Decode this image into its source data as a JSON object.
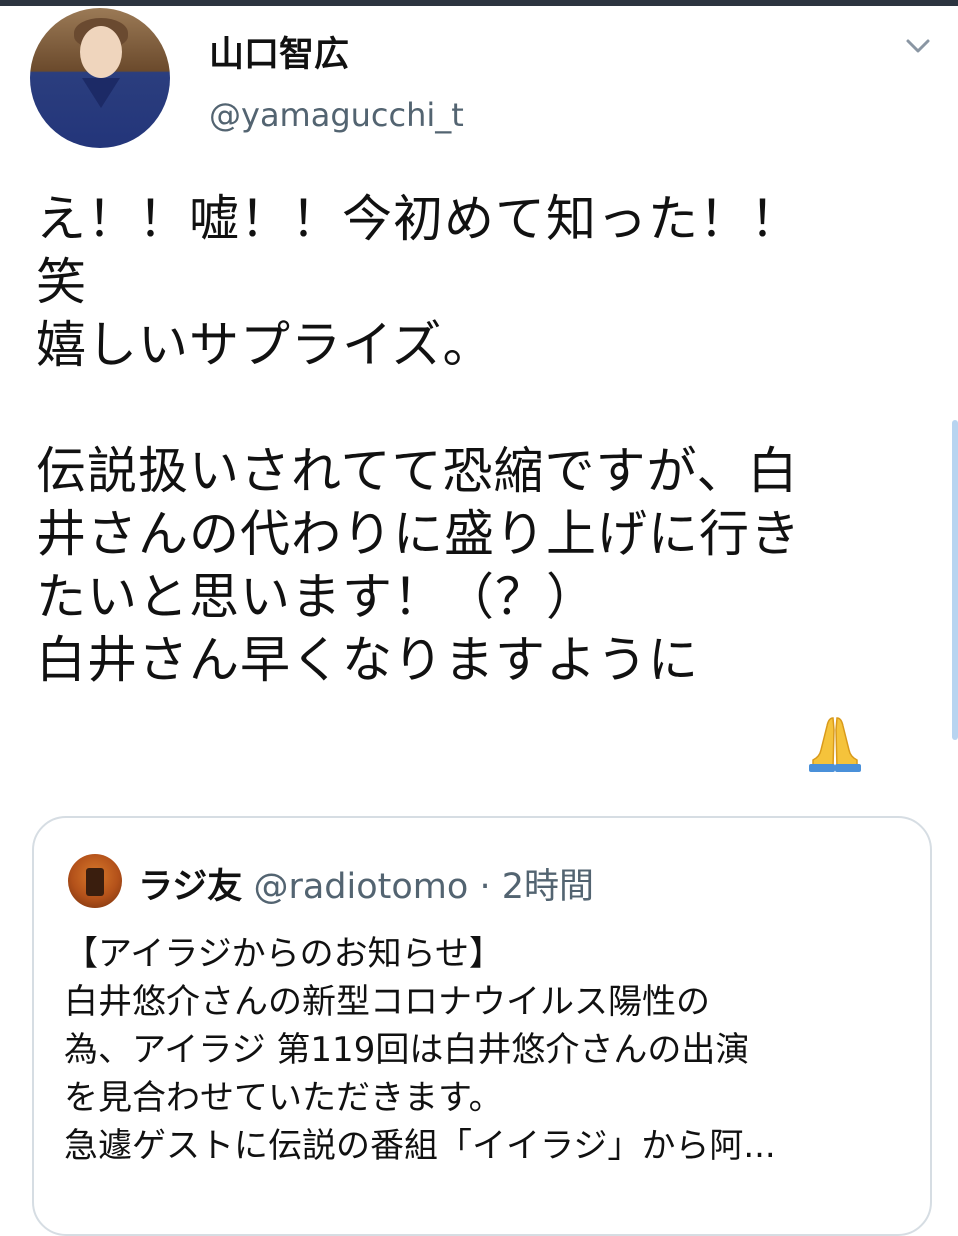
{
  "author": {
    "display_name": "山口智広",
    "handle": "@yamagucchi_t",
    "avatar_icon": "user-avatar-photo"
  },
  "tweet": {
    "text": "え！！嘘！！今初めて知った！！\n笑\n嬉しいサプライズ。\n\n伝説扱いされてて恐縮ですが、白\n井さんの代わりに盛り上げに行き\nたいと思います！（？）\n白井さん早くなりますように",
    "emoji_icon": "folded-hands-icon"
  },
  "quoted_tweet": {
    "name": "ラジ友",
    "handle": "@radiotomo",
    "separator": "·",
    "time": "2時間",
    "text": "【アイラジからのお知らせ】\n白井悠介さんの新型コロナウイルス陽性の\n為、アイラジ 第119回は白井悠介さんの出演\nを見合わせていただきます。\n急遽ゲストに伝説の番組「イイラジ」から阿..."
  },
  "colors": {
    "text": "#111111",
    "secondary": "#536471",
    "border": "#d6dde3",
    "background": "#ffffff"
  }
}
